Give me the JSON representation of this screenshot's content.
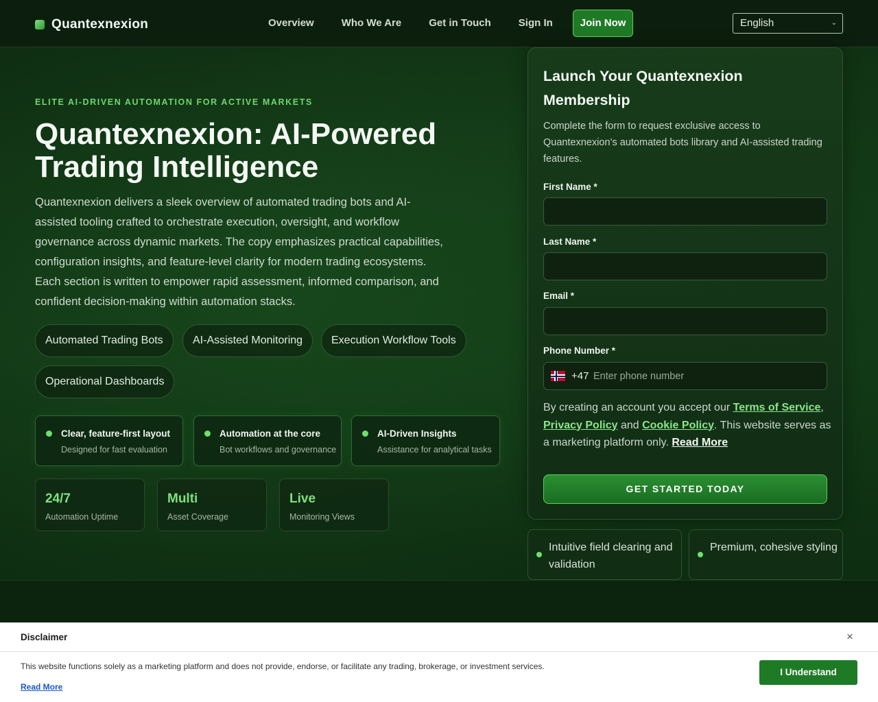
{
  "header": {
    "brand": "Quantexnexion",
    "nav": [
      "Overview",
      "Who We Are",
      "Get in Touch",
      "Sign In"
    ],
    "cta": "Join Now",
    "language": "English"
  },
  "hero": {
    "eyebrow": "ELITE AI-DRIVEN AUTOMATION FOR ACTIVE MARKETS",
    "title": "Quantexnexion: AI-Powered Trading Intelligence",
    "description": "Quantexnexion delivers a sleek overview of automated trading bots and AI-assisted tooling crafted to orchestrate execution, oversight, and workflow governance across dynamic markets. The copy emphasizes practical capabilities, configuration insights, and feature-level clarity for modern trading ecosystems. Each section is written to empower rapid assessment, informed comparison, and confident decision-making within automation stacks.",
    "chips": [
      "Automated Trading Bots",
      "AI-Assisted Monitoring",
      "Execution Workflow Tools",
      "Operational Dashboards"
    ],
    "features": [
      {
        "title": "Clear, feature-first layout",
        "subtitle": "Designed for fast evaluation"
      },
      {
        "title": "Automation at the core",
        "subtitle": "Bot workflows and governance"
      },
      {
        "title": "AI-Driven Insights",
        "subtitle": "Assistance for analytical tasks"
      }
    ],
    "stats": [
      {
        "value": "24/7",
        "label": "Automation Uptime"
      },
      {
        "value": "Multi",
        "label": "Asset Coverage"
      },
      {
        "value": "Live",
        "label": "Monitoring Views"
      }
    ]
  },
  "form": {
    "title": "Launch Your Quantexnexion Membership",
    "description": "Complete the form to request exclusive access to Quantexnexion’s automated bots library and AI-assisted trading features.",
    "first_name_label": "First Name *",
    "last_name_label": "Last Name *",
    "email_label": "Email *",
    "phone_label": "Phone Number *",
    "phone_code": "+47",
    "phone_placeholder": "Enter phone number",
    "consent_prefix": "By creating an account you accept our ",
    "terms_link": "Terms of Service",
    "comma": ",",
    "privacy_link": "Privacy Policy",
    "and": " and ",
    "cookie_link": "Cookie Policy",
    "consent_suffix": ". This website serves as a marketing platform only. ",
    "read_more": "Read More",
    "submit": "GET STARTED TODAY"
  },
  "perks": [
    "Intuitive field clearing and validation",
    "Premium, cohesive styling"
  ],
  "disclaimer": {
    "title": "Disclaimer",
    "close": "×",
    "text": "This website functions solely as a marketing platform and does not provide, endorse, or facilitate any trading, brokerage, or investment services.",
    "read_more": "Read More",
    "button": "I Understand"
  }
}
